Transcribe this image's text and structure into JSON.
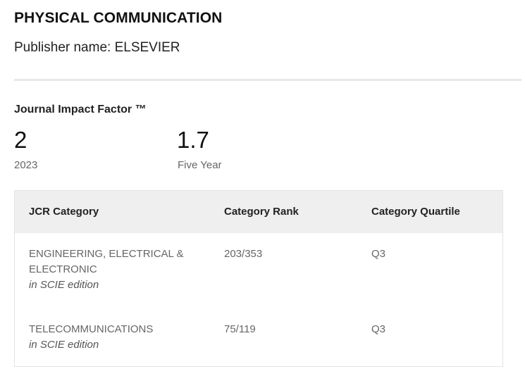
{
  "journal": {
    "title": "PHYSICAL COMMUNICATION",
    "publisher": "Publisher name: ELSEVIER"
  },
  "impact_factor": {
    "heading": "Journal Impact Factor ™",
    "metrics": [
      {
        "value": "2",
        "label": "2023"
      },
      {
        "value": "1.7",
        "label": "Five Year"
      }
    ]
  },
  "jcr_table": {
    "headers": [
      "JCR Category",
      "Category Rank",
      "Category Quartile"
    ],
    "rows": [
      {
        "category": "ENGINEERING, ELECTRICAL & ELECTRONIC",
        "edition": "in SCIE edition",
        "rank": "203/353",
        "quartile": "Q3"
      },
      {
        "category": "TELECOMMUNICATIONS",
        "edition": "in SCIE edition",
        "rank": "75/119",
        "quartile": "Q3"
      }
    ]
  }
}
